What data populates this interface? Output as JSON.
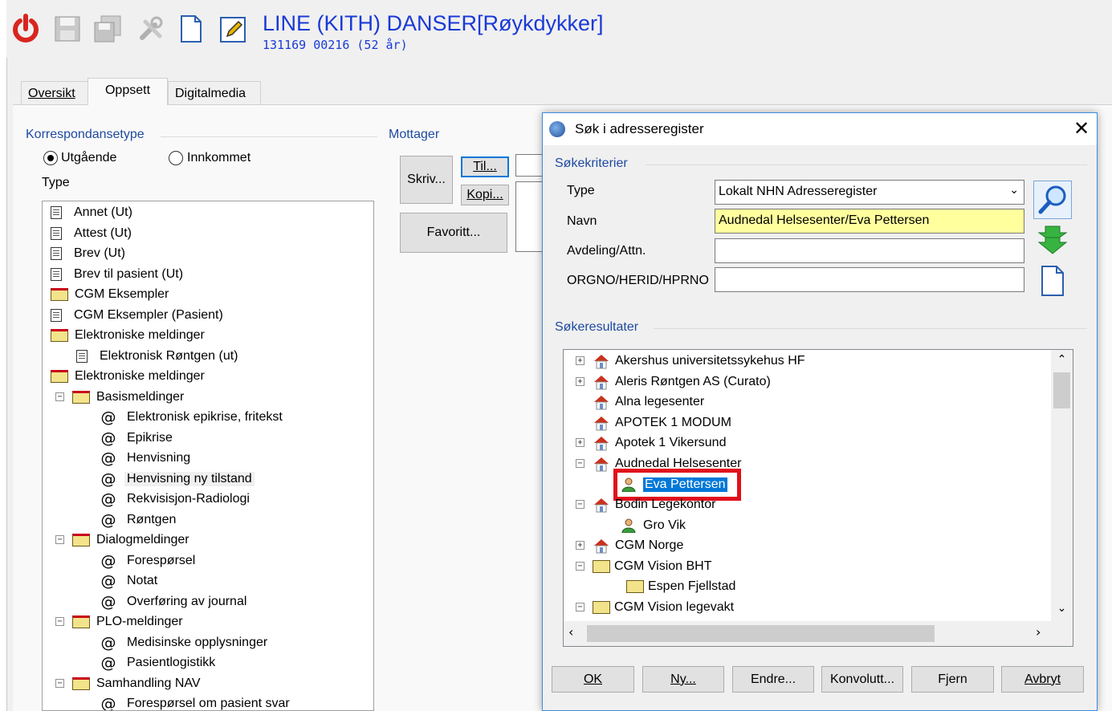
{
  "header": {
    "title": "LINE (KITH) DANSER[Røykdykker]",
    "subtitle": "131169 00216 (52 år)"
  },
  "toolbar": {
    "icons": [
      "power-icon",
      "save-icon",
      "save-all-icon",
      "tools-icon",
      "new-document-icon",
      "edit-icon"
    ]
  },
  "tabs": [
    "Oversikt",
    "Oppsett",
    "Digitalmedia"
  ],
  "left": {
    "group_label": "Korrespondansetype",
    "radio_out": "Utgående",
    "radio_in": "Innkommet",
    "type_label": "Type",
    "tree": [
      {
        "label": "Annet (Ut)",
        "icon": "doc"
      },
      {
        "label": "Attest (Ut)",
        "icon": "doc"
      },
      {
        "label": "Brev (Ut)",
        "icon": "doc"
      },
      {
        "label": "Brev til pasient (Ut)",
        "icon": "doc"
      },
      {
        "label": "CGM Eksempler",
        "icon": "folder"
      },
      {
        "label": "CGM Eksempler (Pasient)",
        "icon": "doc"
      },
      {
        "label": "Elektroniske meldinger",
        "icon": "folder"
      },
      {
        "label": "Elektronisk Røntgen (ut)",
        "icon": "doc"
      },
      {
        "label": "Elektroniske meldinger",
        "icon": "folder"
      },
      {
        "label": "Basismeldinger",
        "icon": "folder"
      },
      {
        "label": "Elektronisk epikrise, fritekst",
        "icon": "at"
      },
      {
        "label": "Epikrise",
        "icon": "at"
      },
      {
        "label": "Henvisning",
        "icon": "at"
      },
      {
        "label": "Henvisning ny tilstand",
        "icon": "at"
      },
      {
        "label": "Rekvisisjon-Radiologi",
        "icon": "at"
      },
      {
        "label": "Røntgen",
        "icon": "at"
      },
      {
        "label": "Dialogmeldinger",
        "icon": "folder"
      },
      {
        "label": "Forespørsel",
        "icon": "at"
      },
      {
        "label": "Notat",
        "icon": "at"
      },
      {
        "label": "Overføring av journal",
        "icon": "at"
      },
      {
        "label": "PLO-meldinger",
        "icon": "folder"
      },
      {
        "label": "Medisinske opplysninger",
        "icon": "at"
      },
      {
        "label": "Pasientlogistikk",
        "icon": "at"
      },
      {
        "label": "Samhandling NAV",
        "icon": "folder"
      },
      {
        "label": "Forespørsel om pasient svar",
        "icon": "at"
      }
    ]
  },
  "mottager": {
    "label": "Mottager",
    "skriv": "Skriv...",
    "til": "Til...",
    "kopi": "Kopi...",
    "favoritt": "Favoritt..."
  },
  "dialog": {
    "title": "Søk i adresseregister",
    "criteria_label": "Søkekriterier",
    "type_label": "Type",
    "type_value": "Lokalt NHN Adresseregister",
    "name_label": "Navn",
    "name_value": "Audnedal Helsesenter/Eva Pettersen",
    "dept_label": "Avdeling/Attn.",
    "dept_value": "",
    "org_label": "ORGNO/HERID/HPRNO",
    "org_value": "",
    "results_label": "Søkeresultater",
    "results": [
      {
        "label": "Akershus universitetssykehus HF",
        "icon": "hospital"
      },
      {
        "label": "Aleris Røntgen AS (Curato)",
        "icon": "hospital"
      },
      {
        "label": "Alna legesenter",
        "icon": "hospital"
      },
      {
        "label": "APOTEK 1 MODUM",
        "icon": "hospital"
      },
      {
        "label": "Apotek 1 Vikersund",
        "icon": "hospital"
      },
      {
        "label": "Audnedal Helsesenter",
        "icon": "hospital"
      },
      {
        "label": "Eva Pettersen",
        "icon": "person"
      },
      {
        "label": "Bodin Legekontor",
        "icon": "hospital"
      },
      {
        "label": "Gro Vik",
        "icon": "person"
      },
      {
        "label": "CGM Norge",
        "icon": "hospital"
      },
      {
        "label": "CGM Vision BHT",
        "icon": "folder"
      },
      {
        "label": "Espen Fjellstad",
        "icon": "folder"
      },
      {
        "label": "CGM Vision legevakt",
        "icon": "folder"
      }
    ],
    "buttons": {
      "ok": "OK",
      "ny": "Ny...",
      "endre": "Endre...",
      "konvolutt": "Konvolutt...",
      "fjern": "Fjern",
      "avbryt": "Avbryt"
    },
    "side_icons": [
      "search-icon",
      "download-arrow-icon",
      "new-document-icon"
    ]
  },
  "colors": {
    "title_blue": "#1a3ad6",
    "highlight_red": "#e0101c",
    "selection": "#0078d7",
    "name_field_bg": "#ffff9e"
  }
}
